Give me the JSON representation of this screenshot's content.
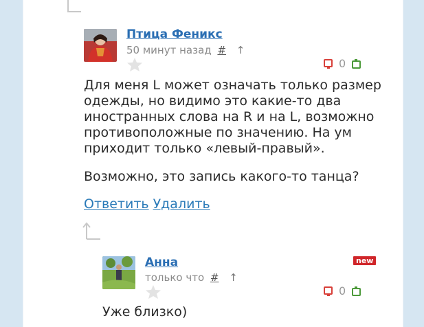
{
  "comments": [
    {
      "author": "Птица Феникс",
      "time": "50 минут назад",
      "permalink": "#",
      "up": "↑",
      "votes": "0",
      "text_lines": [
        "Для меня L может означать только размер",
        "одежды, но видимо это какие-то два",
        "иностранных слова на R и на  L, возможно",
        "противоположные по значению.  На ум",
        "приходит только «левый-правый»."
      ],
      "text_line2": "Возможно, это запись какого-то танца?",
      "reply": "Ответить",
      "delete": "Удалить"
    },
    {
      "author": "Анна",
      "time": "только что",
      "permalink": "#",
      "up": "↑",
      "votes": "0",
      "badge": "new",
      "text": "Уже близко)"
    }
  ]
}
